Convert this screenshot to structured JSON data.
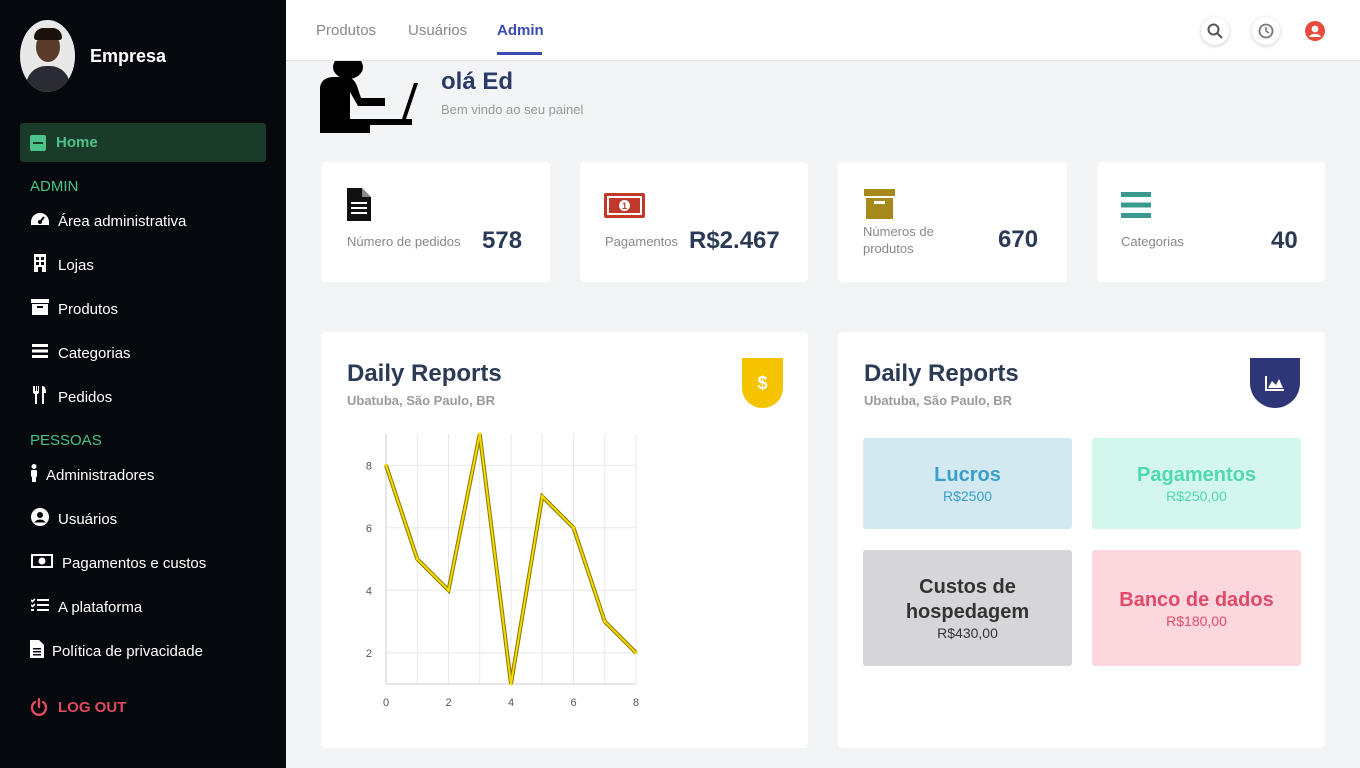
{
  "sidebar": {
    "brand": "Empresa",
    "home": "Home",
    "section_admin": "ADMIN",
    "section_people": "PESSOAS",
    "items": [
      {
        "label": "Área administrativa",
        "icon": "dashboard-icon"
      },
      {
        "label": "Lojas",
        "icon": "building-icon"
      },
      {
        "label": "Produtos",
        "icon": "archive-icon"
      },
      {
        "label": "Categorias",
        "icon": "bars-icon"
      },
      {
        "label": "Pedidos",
        "icon": "utensils-icon"
      },
      {
        "label": "Administradores",
        "icon": "person-icon"
      },
      {
        "label": "Usuários",
        "icon": "user-circle-icon"
      },
      {
        "label": "Pagamentos e custos",
        "icon": "money-icon"
      },
      {
        "label": "A plataforma",
        "icon": "checklist-icon"
      },
      {
        "label": "Política de privacidade",
        "icon": "file-icon"
      }
    ],
    "logout": "LOG OUT"
  },
  "topbar": {
    "tabs": [
      "Produtos",
      "Usuários",
      "Admin"
    ],
    "active_tab": "Admin",
    "icons": [
      "search-icon",
      "clock-icon",
      "user-icon"
    ]
  },
  "greeting": {
    "hello": "olá Ed",
    "welcome": "Bem vindo ao seu painel"
  },
  "stats": [
    {
      "label": "Número de pedidos",
      "value": "578",
      "icon": "document-icon",
      "color": "#111111"
    },
    {
      "label": "Pagamentos",
      "value": "R$2.467",
      "icon": "money-icon",
      "color": "#c0392b"
    },
    {
      "label": "Números de produtos",
      "value": "670",
      "icon": "archive-icon",
      "color": "#a5891a"
    },
    {
      "label": "Categorias",
      "value": "40",
      "icon": "bars-icon",
      "color": "#3a9a8e"
    }
  ],
  "report_left": {
    "title": "Daily Reports",
    "subtitle": "Ubatuba, São Paulo, BR",
    "badge": "$",
    "badge_color": "#f5c400"
  },
  "report_right": {
    "title": "Daily Reports",
    "subtitle": "Ubatuba, São Paulo, BR",
    "badge_color": "#2f3677",
    "tiles": [
      {
        "title": "Lucros",
        "value": "R$2500",
        "bg": "#d2e9f2",
        "color": "#3a9fc8"
      },
      {
        "title": "Pagamentos",
        "value": "R$250,00",
        "bg": "#d3f7ec",
        "color": "#4fd9b0"
      },
      {
        "title": "Custos de hospedagem",
        "value": "R$430,00",
        "bg": "#d6d6d8",
        "color": "#333333"
      },
      {
        "title": "Banco de dados",
        "value": "R$180,00",
        "bg": "#fcd7de",
        "color": "#e04a6a"
      }
    ]
  },
  "chart_data": {
    "type": "line",
    "x": [
      0,
      1,
      2,
      3,
      4,
      5,
      6,
      7,
      8
    ],
    "series": [
      {
        "values": [
          8,
          5,
          4,
          9,
          1,
          7,
          6,
          3,
          2
        ],
        "color": "#f5d800"
      }
    ],
    "x_ticks": [
      "0",
      "2",
      "4",
      "6",
      "8"
    ],
    "y_ticks": [
      "2",
      "4",
      "6",
      "8"
    ],
    "xlim": [
      0,
      8
    ],
    "ylim": [
      1,
      9
    ],
    "grid": true
  }
}
